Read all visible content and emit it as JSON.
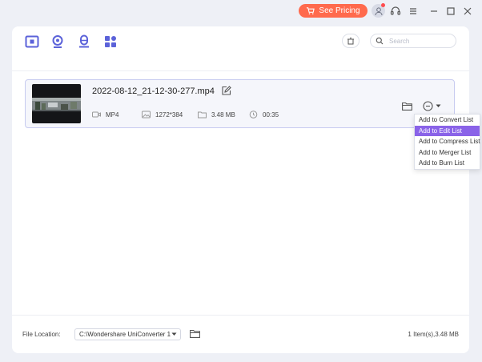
{
  "titlebar": {
    "pricing_label": "See Pricing"
  },
  "search": {
    "placeholder": "Search"
  },
  "file": {
    "name": "2022-08-12_21-12-30-277.mp4",
    "format": "MP4",
    "resolution": "1272*384",
    "size": "3.48 MB",
    "duration": "00:35"
  },
  "menu": {
    "items": [
      "Add to Convert List",
      "Add to Edit List",
      "Add to Compress List",
      "Add to Merger List",
      "Add to Burn List"
    ],
    "active_index": 1
  },
  "footer": {
    "location_label": "File Location:",
    "location_value": "C:\\Wondershare UniConverter 1",
    "summary": "1 Item(s),3.48 MB"
  },
  "colors": {
    "accent": "#5b62d9",
    "pricing": "#ff6a4d",
    "menu_highlight": "#8a63e8"
  }
}
